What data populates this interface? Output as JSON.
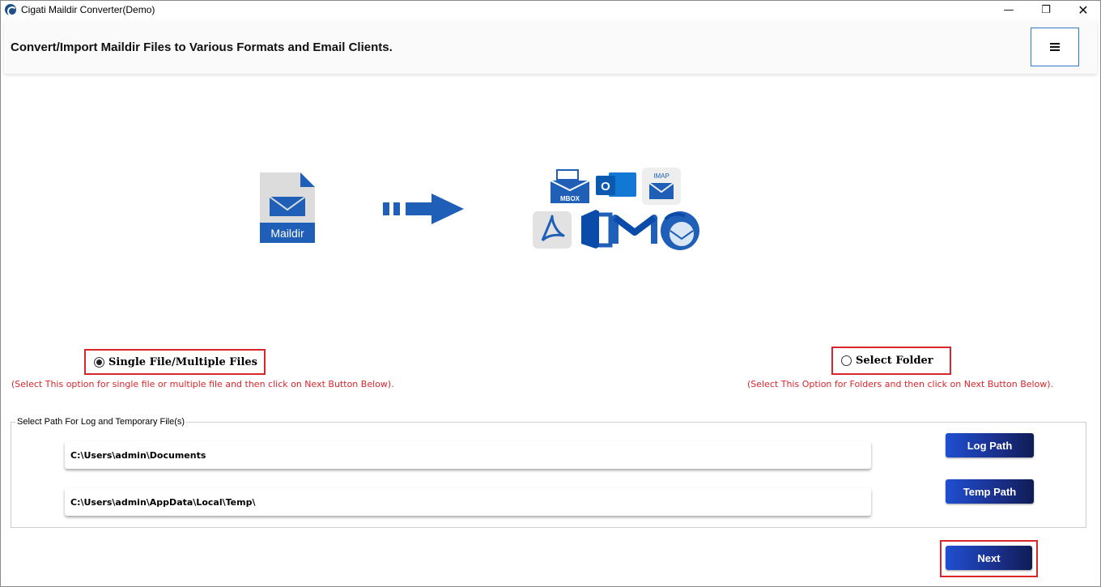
{
  "window": {
    "title": "Cigati Maildir Converter(Demo)",
    "minimize_glyph": "—",
    "maximize_glyph": "❐",
    "close_glyph": "✕"
  },
  "header": {
    "title": "Convert/Import Maildir Files to Various Formats and Email Clients.",
    "menu_icon": "hamburger-menu-icon"
  },
  "illustration": {
    "source_label": "Maildir",
    "targets": [
      {
        "name": "mbox",
        "label": "MBOX"
      },
      {
        "name": "outlook",
        "label": "O"
      },
      {
        "name": "imap",
        "label": "IMAP"
      },
      {
        "name": "pdf"
      },
      {
        "name": "office365"
      },
      {
        "name": "gmail"
      },
      {
        "name": "thunderbird"
      }
    ]
  },
  "options": {
    "single": {
      "label": "Single File/Multiple Files",
      "selected": true,
      "hint": "(Select This option for single file or multiple file and then click on Next Button Below)."
    },
    "folder": {
      "label": "Select Folder",
      "selected": false,
      "hint": "(Select This Option for Folders and then click on Next Button Below)."
    }
  },
  "paths": {
    "group_label": "Select Path For Log and Temporary File(s)",
    "log_path": "C:\\Users\\admin\\Documents",
    "temp_path": "C:\\Users\\admin\\AppData\\Local\\Temp\\",
    "log_button": "Log Path",
    "temp_button": "Temp Path"
  },
  "footer": {
    "next_button": "Next"
  },
  "colors": {
    "accent_red": "#d9262c",
    "button_blue": "#1a2f8a",
    "maildir_blue": "#1f5fb8"
  }
}
